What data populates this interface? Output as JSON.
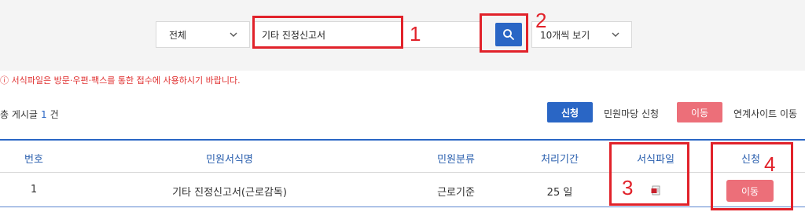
{
  "search": {
    "category_value": "전체",
    "keyword_value": "기타 진정신고서",
    "per_page_value": "10개씩 보기"
  },
  "notice": "서식파일은 방문·우편·팩스를 통한 접수에 사용하시기 바랍니다.",
  "summary": {
    "total_label_prefix": "총 게시글",
    "total_count": "1",
    "total_unit": "건"
  },
  "legend": {
    "apply_button": "신청",
    "apply_desc": "민원마당 신청",
    "move_button": "이동",
    "move_desc": "연계사이트 이동"
  },
  "table": {
    "headers": [
      "번호",
      "민원서식명",
      "민원분류",
      "처리기간",
      "서식파일",
      "신청"
    ],
    "rows": [
      {
        "no": "1",
        "form_name": "기타 진정신고서(근로감독)",
        "category": "근로기준",
        "period": "25 일",
        "action": "이동"
      }
    ]
  },
  "annotations": {
    "n1": "1",
    "n2": "2",
    "n3": "3",
    "n4": "4"
  },
  "colors": {
    "primary": "#2a66c5",
    "move": "#ec6f79",
    "notice": "#e03131",
    "annotation": "#e1222a"
  }
}
